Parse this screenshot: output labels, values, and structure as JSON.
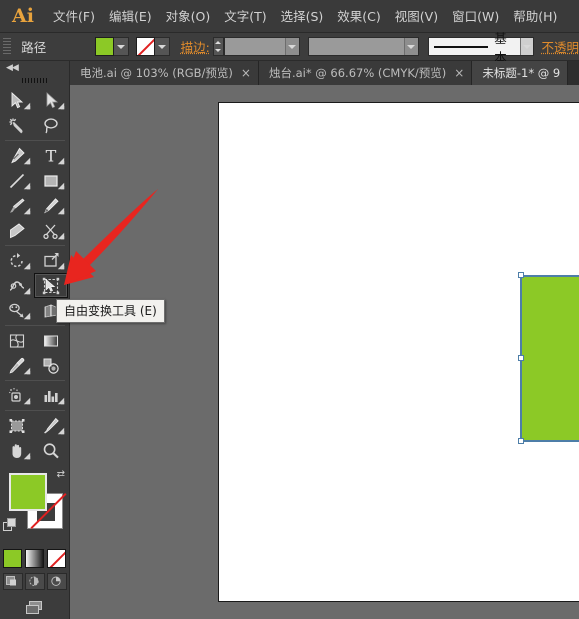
{
  "app": {
    "logo": "Ai",
    "accent_orange": "#e08b2c",
    "shape_green": "#8cc926",
    "selection_blue": "#4d7ea8",
    "panel_bg": "#3c3c3c",
    "canvas_bg": "#6b6b6b"
  },
  "menubar": {
    "items": [
      {
        "label": "文件(F)"
      },
      {
        "label": "编辑(E)"
      },
      {
        "label": "对象(O)"
      },
      {
        "label": "文字(T)"
      },
      {
        "label": "选择(S)"
      },
      {
        "label": "效果(C)"
      },
      {
        "label": "视图(V)"
      },
      {
        "label": "窗口(W)"
      },
      {
        "label": "帮助(H)"
      }
    ]
  },
  "controlbar": {
    "object_type": "路径",
    "fill_label": "填色",
    "fill_color": "#8cc926",
    "stroke_color_label": "描边颜色",
    "stroke_color": "无",
    "stroke_label": "描边:",
    "stroke_weight_value": "",
    "stroke_profile_value": "",
    "brush_definition_value": "基本",
    "opacity_label": "不透明",
    "style_line": "———"
  },
  "tabbar": {
    "tabs": [
      {
        "label": "电池.ai @ 103% (RGB/预览)",
        "close": "×",
        "active": false
      },
      {
        "label": "烛台.ai* @ 66.67% (CMYK/预览)",
        "close": "×",
        "active": false
      },
      {
        "label": "未标题-1* @ 9",
        "close": "",
        "active": true
      }
    ]
  },
  "toolpanel": {
    "collapse_label": "◀◀",
    "tools": [
      {
        "name": "selection-tool",
        "row": 0,
        "col": 0,
        "more": true,
        "selected": false
      },
      {
        "name": "direct-selection-tool",
        "row": 0,
        "col": 1,
        "more": true,
        "selected": false
      },
      {
        "name": "magic-wand-tool",
        "row": 1,
        "col": 0,
        "more": false,
        "selected": false
      },
      {
        "name": "lasso-tool",
        "row": 1,
        "col": 1,
        "more": false,
        "selected": false
      },
      {
        "name": "pen-tool",
        "row": 2,
        "col": 0,
        "more": true,
        "selected": false
      },
      {
        "name": "type-tool",
        "row": 2,
        "col": 1,
        "more": true,
        "selected": false
      },
      {
        "name": "line-segment-tool",
        "row": 3,
        "col": 0,
        "more": true,
        "selected": false
      },
      {
        "name": "rectangle-tool",
        "row": 3,
        "col": 1,
        "more": true,
        "selected": false
      },
      {
        "name": "paintbrush-tool",
        "row": 4,
        "col": 0,
        "more": true,
        "selected": false
      },
      {
        "name": "pencil-tool",
        "row": 4,
        "col": 1,
        "more": true,
        "selected": false
      },
      {
        "name": "blob-brush-tool",
        "row": 5,
        "col": 0,
        "more": false,
        "selected": false
      },
      {
        "name": "eraser-scissors-tool",
        "row": 5,
        "col": 1,
        "more": true,
        "selected": false
      },
      {
        "name": "rotate-tool",
        "row": 6,
        "col": 0,
        "more": true,
        "selected": false
      },
      {
        "name": "scale-tool",
        "row": 6,
        "col": 1,
        "more": true,
        "selected": false
      },
      {
        "name": "width-warp-tool",
        "row": 7,
        "col": 0,
        "more": true,
        "selected": false
      },
      {
        "name": "free-transform-tool",
        "row": 7,
        "col": 1,
        "more": false,
        "selected": true
      },
      {
        "name": "shape-builder-tool",
        "row": 8,
        "col": 0,
        "more": true,
        "selected": false
      },
      {
        "name": "perspective-grid-tool",
        "row": 8,
        "col": 1,
        "more": true,
        "selected": false
      },
      {
        "name": "mesh-tool",
        "row": 9,
        "col": 0,
        "more": false,
        "selected": false
      },
      {
        "name": "gradient-tool",
        "row": 9,
        "col": 1,
        "more": false,
        "selected": false
      },
      {
        "name": "eyedropper-tool",
        "row": 10,
        "col": 0,
        "more": true,
        "selected": false
      },
      {
        "name": "blend-tool",
        "row": 10,
        "col": 1,
        "more": false,
        "selected": false
      },
      {
        "name": "symbol-sprayer-tool",
        "row": 11,
        "col": 0,
        "more": true,
        "selected": false
      },
      {
        "name": "column-graph-tool",
        "row": 11,
        "col": 1,
        "more": true,
        "selected": false
      },
      {
        "name": "artboard-tool",
        "row": 12,
        "col": 0,
        "more": false,
        "selected": false
      },
      {
        "name": "slice-tool",
        "row": 12,
        "col": 1,
        "more": true,
        "selected": false
      },
      {
        "name": "hand-tool",
        "row": 13,
        "col": 0,
        "more": true,
        "selected": false
      },
      {
        "name": "zoom-tool",
        "row": 13,
        "col": 1,
        "more": false,
        "selected": false
      }
    ],
    "fill_color": "#8cc926",
    "stroke_color": "无",
    "color_modes": [
      {
        "name": "color-swatch",
        "label": "颜色"
      },
      {
        "name": "gradient-swatch",
        "label": "渐变"
      },
      {
        "name": "none-swatch",
        "label": "无"
      }
    ],
    "draw_modes": [
      {
        "name": "draw-normal",
        "label": "正常绘图"
      },
      {
        "name": "draw-behind",
        "label": "背面绘图"
      },
      {
        "name": "draw-inside",
        "label": "内部绘图"
      }
    ],
    "screen_mode_label": "更改屏幕模式"
  },
  "tooltip": {
    "text": "自由变换工具 (E)"
  },
  "canvas": {
    "shape": {
      "name": "green-rectangle",
      "fill": "#8cc926",
      "selected": true,
      "handles": 8
    }
  },
  "annotation": {
    "arrow_color": "#e8251f",
    "points_to": "free-transform-tool"
  }
}
